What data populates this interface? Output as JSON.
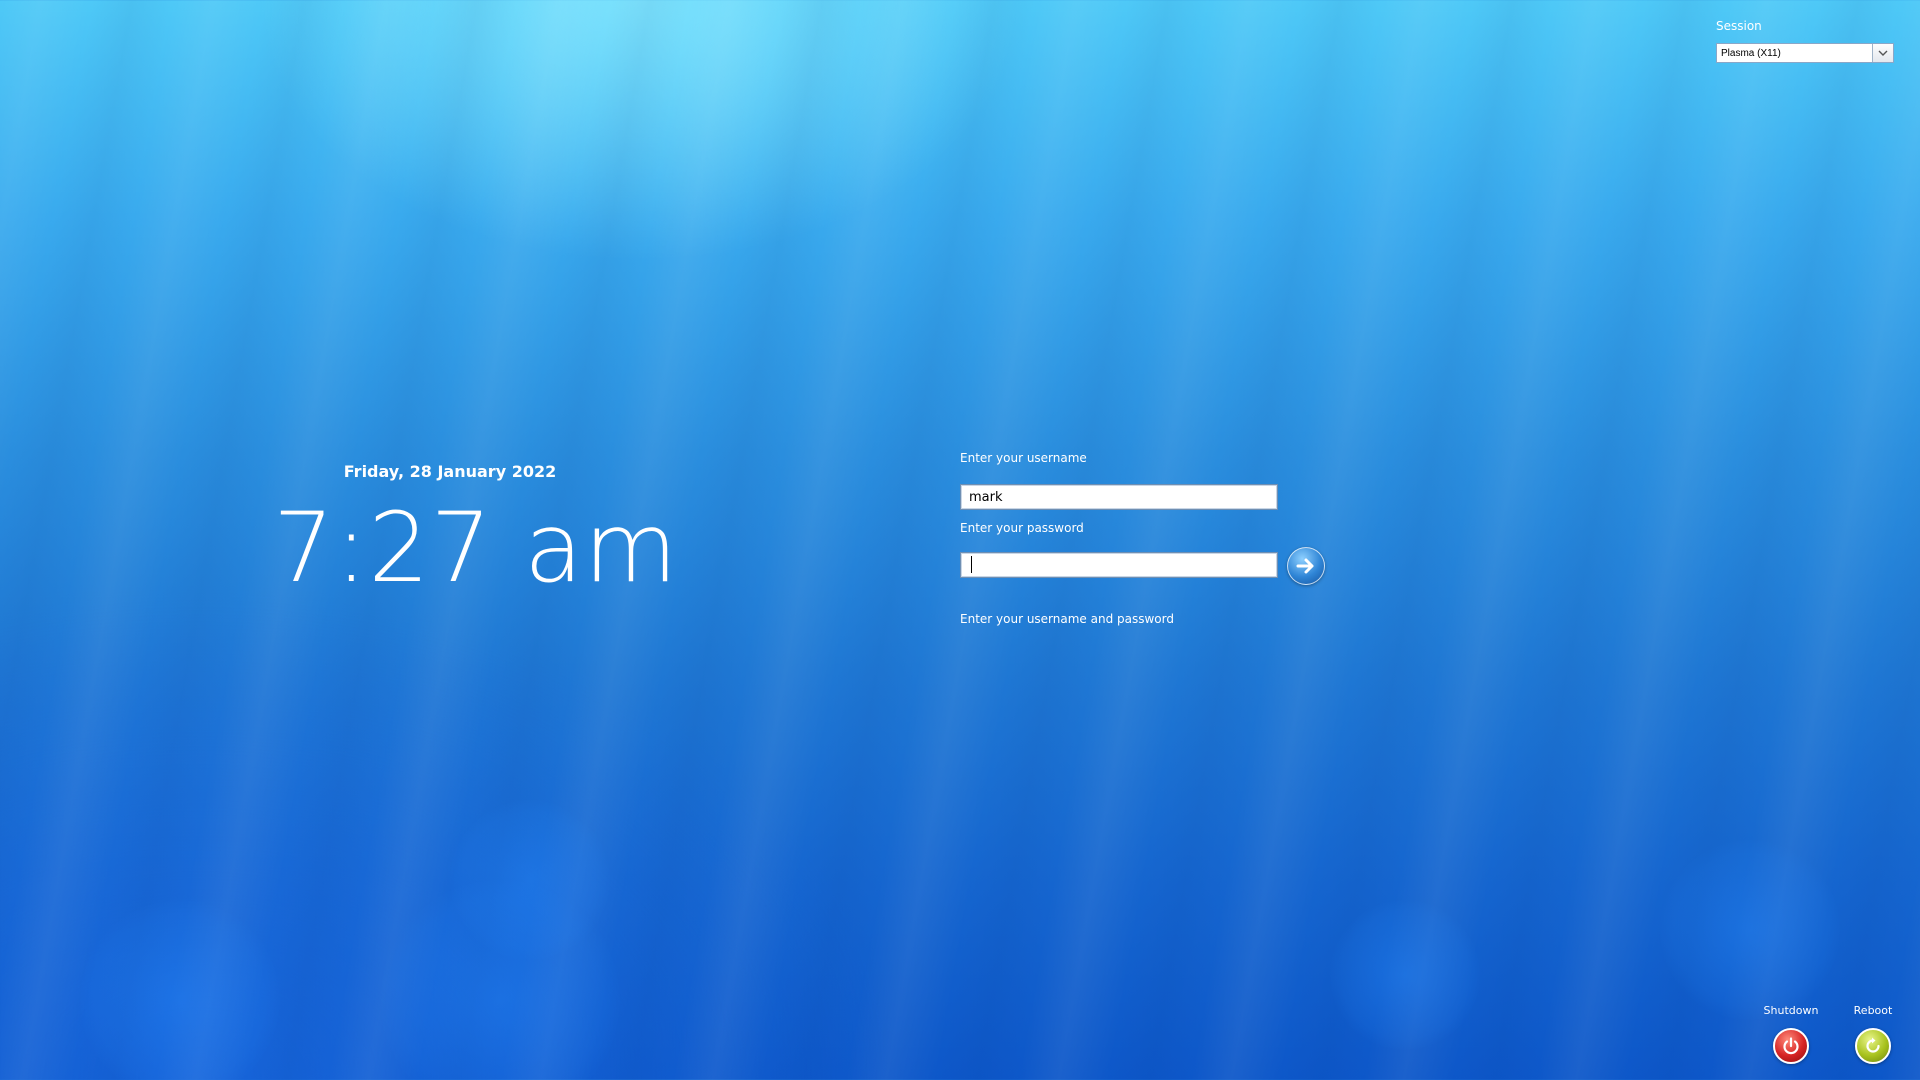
{
  "session": {
    "label": "Session",
    "selected": "Plasma (X11)"
  },
  "clock": {
    "date": "Friday, 28 January 2022",
    "time": "7:27 am"
  },
  "login": {
    "username_label": "Enter your username",
    "username_value": "mark",
    "password_label": "Enter your password",
    "password_value": "",
    "status_message": "Enter your username and password"
  },
  "power": {
    "shutdown_label": "Shutdown",
    "reboot_label": "Reboot"
  },
  "icons": {
    "submit": "arrow-right-icon",
    "shutdown": "power-icon",
    "reboot": "reboot-icon",
    "dropdown": "chevron-down-icon"
  }
}
